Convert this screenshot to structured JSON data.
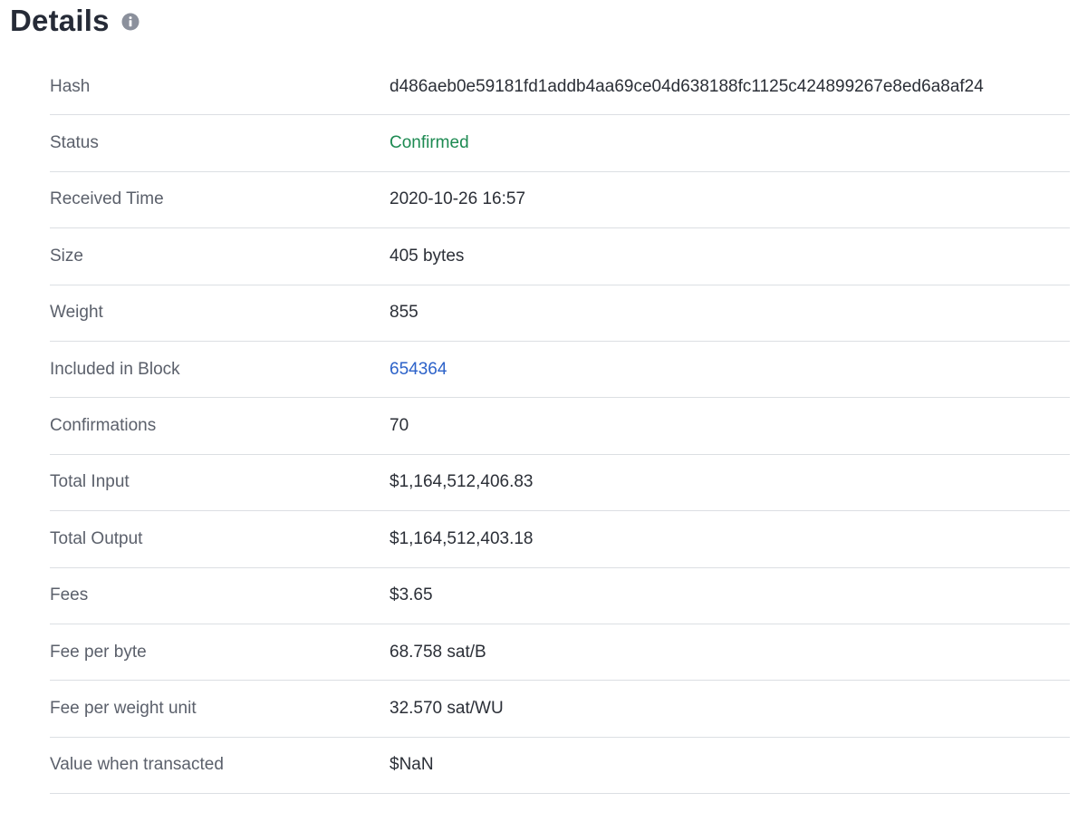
{
  "header": {
    "title": "Details",
    "info_icon": "info-icon"
  },
  "colors": {
    "status_confirmed": "#1d8a52",
    "link": "#2c62c9",
    "label": "#5b606b",
    "value": "#2b2f37",
    "divider": "#dcdfe3"
  },
  "rows": [
    {
      "label": "Hash",
      "value": "d486aeb0e59181fd1addb4aa69ce04d638188fc1125c424899267e8ed6a8af24"
    },
    {
      "label": "Status",
      "value": "Confirmed"
    },
    {
      "label": "Received Time",
      "value": "2020-10-26 16:57"
    },
    {
      "label": "Size",
      "value": "405 bytes"
    },
    {
      "label": "Weight",
      "value": "855"
    },
    {
      "label": "Included in Block",
      "value": "654364"
    },
    {
      "label": "Confirmations",
      "value": "70"
    },
    {
      "label": "Total Input",
      "value": "$1,164,512,406.83"
    },
    {
      "label": "Total Output",
      "value": "$1,164,512,403.18"
    },
    {
      "label": "Fees",
      "value": "$3.65"
    },
    {
      "label": "Fee per byte",
      "value": "68.758 sat/B"
    },
    {
      "label": "Fee per weight unit",
      "value": "32.570 sat/WU"
    },
    {
      "label": "Value when transacted",
      "value": "$NaN"
    }
  ]
}
